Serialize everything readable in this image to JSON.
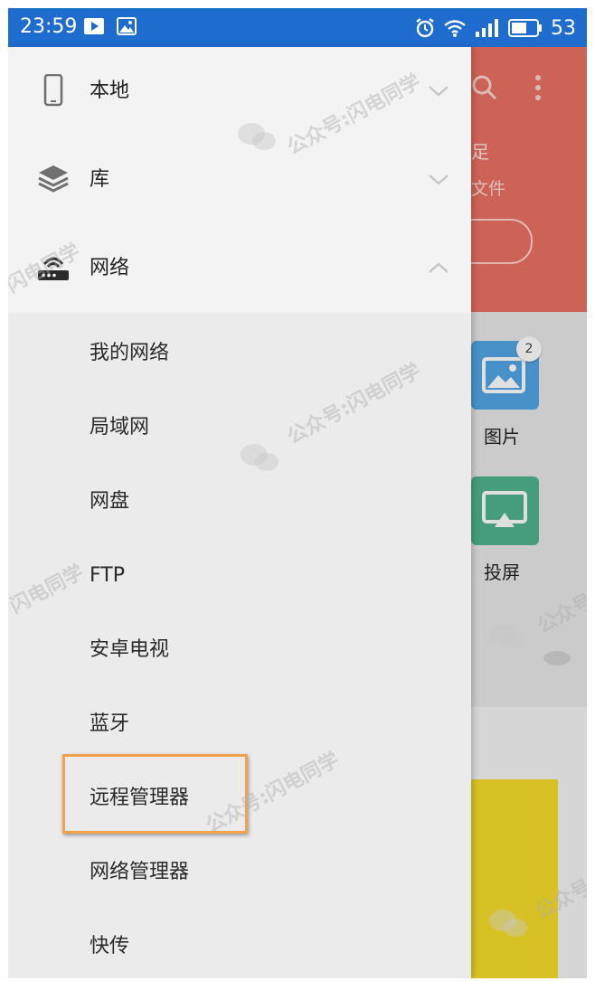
{
  "status_bar": {
    "time": "23:59",
    "battery": "53"
  },
  "background_app": {
    "header_text_1": "足",
    "header_text_2": "文件",
    "tiles": [
      {
        "label": "图片",
        "badge": "2"
      },
      {
        "label": "投屏"
      }
    ]
  },
  "drawer": {
    "sections": [
      {
        "label": "本地",
        "icon": "phone-icon",
        "expanded": false
      },
      {
        "label": "库",
        "icon": "layers-icon",
        "expanded": false
      },
      {
        "label": "网络",
        "icon": "router-icon",
        "expanded": true
      }
    ],
    "network_items": [
      "我的网络",
      "局域网",
      "网盘",
      "FTP",
      "安卓电视",
      "蓝牙",
      "远程管理器",
      "网络管理器",
      "快传"
    ],
    "highlighted_item": "远程管理器"
  },
  "watermark": {
    "account": "公众号:",
    "name": "闪电同学",
    "short": "公众号"
  },
  "colors": {
    "status_bar": "#1f6ccf",
    "header": "#ea7063",
    "highlight_border": "#f2a24b",
    "tile_pics": "#53a5e4",
    "tile_cast": "#4fb38d"
  }
}
